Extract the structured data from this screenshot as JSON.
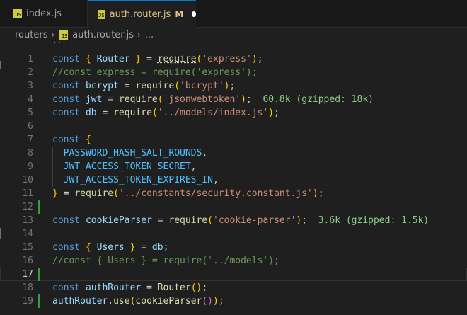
{
  "tabs": [
    {
      "label": "index.js",
      "icon": "js-file-icon"
    },
    {
      "label": "auth.router.js",
      "status": "M",
      "icon": "js-file-icon"
    }
  ],
  "breadcrumb": {
    "folder": "routers",
    "file": "auth.router.js",
    "more": "..."
  },
  "editor": {
    "ellipsis": "···",
    "lines": [
      {
        "n": "1"
      },
      {
        "n": "2"
      },
      {
        "n": "3"
      },
      {
        "n": "4",
        "hint": "60.8k (gzipped: 18k)"
      },
      {
        "n": "5"
      },
      {
        "n": "6"
      },
      {
        "n": "7"
      },
      {
        "n": "8"
      },
      {
        "n": "9"
      },
      {
        "n": "10"
      },
      {
        "n": "11"
      },
      {
        "n": "12"
      },
      {
        "n": "13",
        "hint": "3.6k (gzipped: 1.5k)"
      },
      {
        "n": "14"
      },
      {
        "n": "15"
      },
      {
        "n": "16"
      },
      {
        "n": "17"
      },
      {
        "n": "18"
      },
      {
        "n": "19"
      }
    ]
  },
  "colors": {
    "keyword": "#569cd6",
    "string": "#ce9178",
    "comment": "#6a9955",
    "constant": "#4fc1ff",
    "function": "#dcdcaa",
    "modified": "#e2c08d",
    "added": "#2ea043"
  }
}
